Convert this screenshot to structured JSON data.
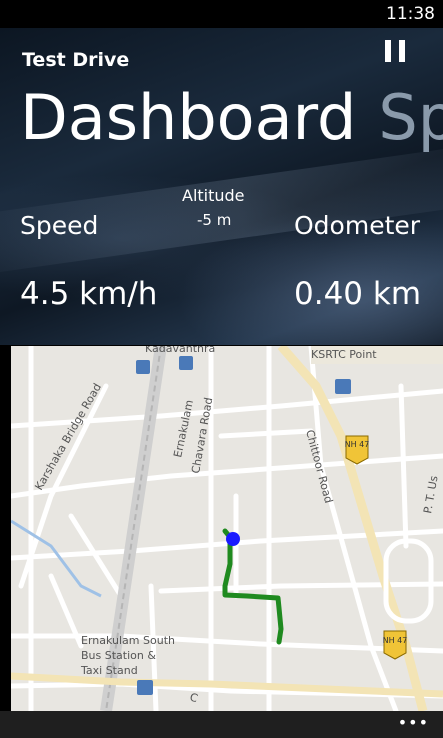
{
  "status_bar": {
    "time": "11:38"
  },
  "app": {
    "title": "Test Drive"
  },
  "pivot": {
    "active": "Dashboard",
    "next": "Speed"
  },
  "stats": {
    "altitude_label": "Altitude",
    "altitude_value": "-5 m",
    "speed_label": "Speed",
    "speed_value": "4.5 km/h",
    "odometer_label": "Odometer",
    "odometer_value": "0.40 km"
  },
  "map": {
    "labels": {
      "kadavanthra": "Kadavanthra",
      "ksrtc_point": "KSRTC Point",
      "karshaka": "Karshaka Bridge Road",
      "ernakulam": "Ernakulam",
      "chavara": "Chavara Road",
      "chittoor": "Chittoor Road",
      "nh47": "NH 47",
      "pt": "P. T. Us",
      "bus_station_1": "Ernakulam South",
      "bus_station_2": "Bus Station &",
      "bus_station_3": "Taxi Stand",
      "c_road": "C"
    },
    "route_color": "#1f8a1f",
    "position_color": "#1a1aff"
  },
  "app_bar": {
    "more": "•••"
  }
}
